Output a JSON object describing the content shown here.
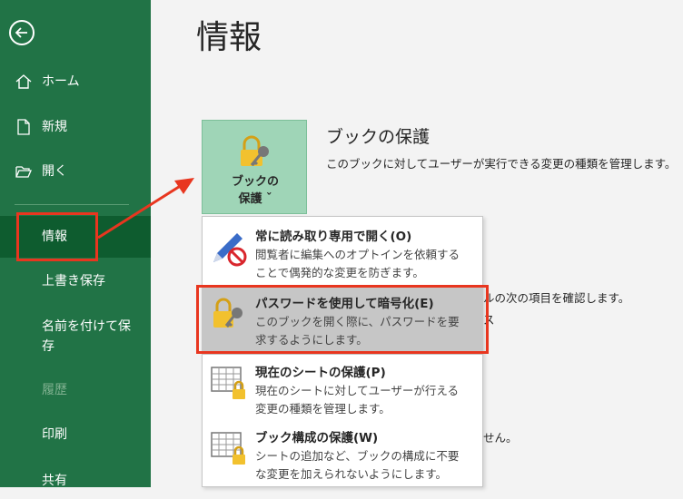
{
  "sidebar": {
    "items": [
      {
        "label": "ホーム"
      },
      {
        "label": "新規"
      },
      {
        "label": "開く"
      },
      {
        "label": "情報"
      },
      {
        "label": "上書き保存"
      },
      {
        "label": "名前を付けて保存"
      },
      {
        "label": "履歴"
      },
      {
        "label": "印刷"
      },
      {
        "label": "共有"
      }
    ]
  },
  "main": {
    "title": "情報",
    "protect_button": {
      "line1": "ブックの",
      "line2": "保護 ˇ"
    },
    "section_title": "ブックの保護",
    "section_desc": "このブックに対してユーザーが実行できる変更の種類を管理します。",
    "bg_fragments": [
      "ルの次の項目を確認します。",
      "ス",
      "せん。"
    ]
  },
  "menu": {
    "items": [
      {
        "title": "常に読み取り専用で開く(O)",
        "desc": "閲覧者に編集へのオプトインを依頼することで偶発的な変更を防ぎます。",
        "icon": "pencil-no-icon"
      },
      {
        "title": "パスワードを使用して暗号化(E)",
        "desc": "このブックを開く際に、パスワードを要求するようにします。",
        "icon": "lock-key-icon"
      },
      {
        "title": "現在のシートの保護(P)",
        "desc": "現在のシートに対してユーザーが行える変更の種類を管理します。",
        "icon": "sheet-lock-icon"
      },
      {
        "title": "ブック構成の保護(W)",
        "desc": "シートの追加など、ブックの構成に不要な変更を加えられないようにします。",
        "icon": "workbook-lock-icon"
      }
    ]
  },
  "colors": {
    "sidebar": "#217346",
    "selected": "#0e5c2f",
    "annotation": "#e8361f",
    "button": "#9fd5b7"
  }
}
